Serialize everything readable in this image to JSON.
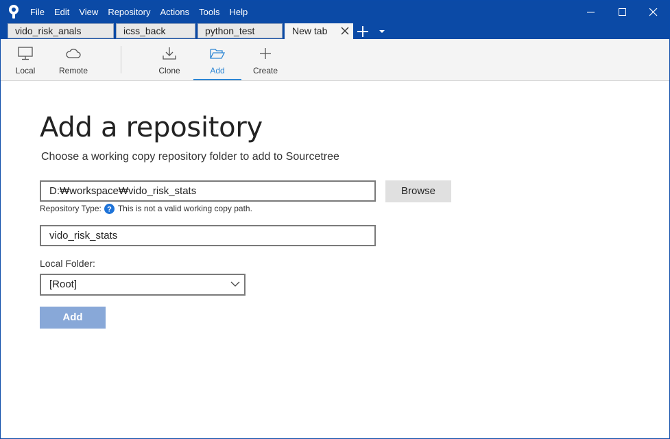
{
  "menu": [
    "File",
    "Edit",
    "View",
    "Repository",
    "Actions",
    "Tools",
    "Help"
  ],
  "tabs": [
    {
      "label": "vido_risk_anals"
    },
    {
      "label": "icss_back"
    },
    {
      "label": "python_test"
    },
    {
      "label": "New tab"
    }
  ],
  "toolbar": {
    "local": "Local",
    "remote": "Remote",
    "clone": "Clone",
    "add": "Add",
    "create": "Create"
  },
  "page": {
    "title": "Add a repository",
    "subtitle": "Choose a working copy repository folder to add to Sourcetree",
    "path_value": "D:₩workspace₩vido_risk_stats",
    "browse_label": "Browse",
    "repo_type_label": "Repository Type:",
    "repo_type_message": "This is not a valid working copy path.",
    "name_value": "vido_risk_stats",
    "local_folder_label": "Local Folder:",
    "local_folder_value": "[Root]",
    "add_label": "Add"
  },
  "colors": {
    "titlebar": "#0b4aa6",
    "accent": "#2d86d4",
    "add_button_disabled": "#88a8d8"
  },
  "icons": {
    "logo": "sourcetree-logo-icon",
    "local": "monitor-icon",
    "remote": "cloud-icon",
    "clone": "download-icon",
    "add": "folder-open-icon",
    "create": "plus-icon",
    "help": "question-icon"
  }
}
